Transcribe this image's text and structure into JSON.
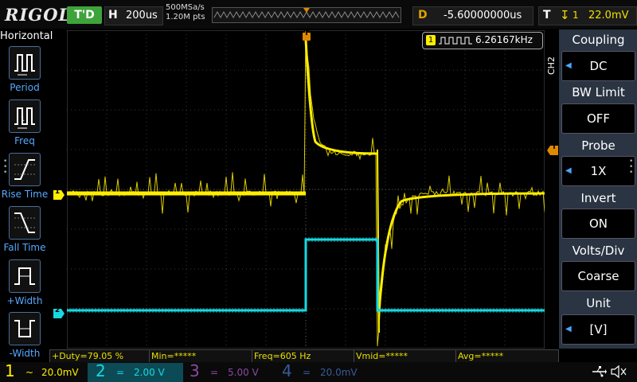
{
  "top": {
    "brand": "RIGOL",
    "run_state": "T'D",
    "timebase_key": "H",
    "timebase_value": "200us",
    "sample_rate": "500MSa/s",
    "memory_points": "1.20M pts",
    "delay_key": "D",
    "delay_value": "-5.60000000us",
    "trigger_key": "T",
    "trigger_source": "1",
    "trigger_level": "22.0mV",
    "trigger_marker": "T"
  },
  "left_menu": {
    "title": "Horizontal",
    "items": [
      {
        "label": "Period",
        "icon": "period-waveform-icon"
      },
      {
        "label": "Freq",
        "icon": "frequency-waveform-icon"
      },
      {
        "label": "Rise Time",
        "icon": "rise-time-icon"
      },
      {
        "label": "Fall Time",
        "icon": "fall-time-icon"
      },
      {
        "label": "+Width",
        "icon": "positive-width-icon"
      },
      {
        "label": "-Width",
        "icon": "negative-width-icon"
      }
    ]
  },
  "right_menu": {
    "channel_tag": "CH2",
    "items": [
      {
        "title": "Coupling",
        "value": "DC"
      },
      {
        "title": "BW Limit",
        "value": "OFF"
      },
      {
        "title": "Probe",
        "value": "1X"
      },
      {
        "title": "Invert",
        "value": "ON"
      },
      {
        "title": "Volts/Div",
        "value": "Coarse"
      },
      {
        "title": "Unit",
        "value": "[V]"
      }
    ]
  },
  "freq_counter": {
    "channel": "1",
    "value": "6.26167kHz"
  },
  "channel_markers": {
    "ch1": "1",
    "ch2": "2",
    "trigger_level": "T"
  },
  "measurements": [
    "+Duty=79.05 %",
    "Min=*****",
    "Freq=605 Hz",
    "Vmid=*****",
    "Avg=*****"
  ],
  "channels": [
    {
      "num": "1",
      "coupling": "~",
      "scale": "20.0mV",
      "color": "#ffee00"
    },
    {
      "num": "2",
      "coupling": "=",
      "scale": "2.00 V",
      "color": "#18d8e0"
    },
    {
      "num": "3",
      "coupling": "=",
      "scale": "5.00 V",
      "color": "#8a4aa0"
    },
    {
      "num": "4",
      "coupling": "=",
      "scale": "20.0mV",
      "color": "#3a5a9a"
    }
  ],
  "colors": {
    "ch1": "#ffee00",
    "ch2": "#18d8e0",
    "accent": "#e08800"
  },
  "status_icons": [
    "usb-icon",
    "speaker-muted-icon"
  ]
}
